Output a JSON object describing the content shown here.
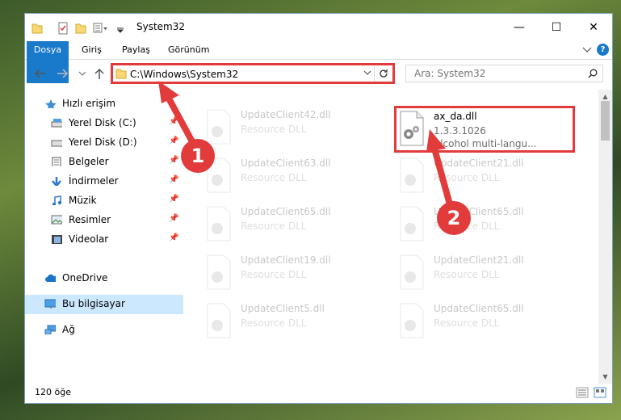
{
  "window": {
    "title": "System32",
    "minimize": "—",
    "maximize": "☐",
    "close": "✕"
  },
  "ribbon": {
    "tabs": [
      "Dosya",
      "Giriş",
      "Paylaş",
      "Görünüm"
    ],
    "help": "?"
  },
  "address": {
    "path": "C:\\Windows\\System32",
    "search_placeholder": "Ara: System32"
  },
  "sidebar": {
    "items": [
      {
        "label": "Hızlı erişim",
        "icon": "star-icon",
        "pinned": false
      },
      {
        "label": "Yerel Disk (C:)",
        "icon": "drive-icon",
        "pinned": true
      },
      {
        "label": "Yerel Disk (D:)",
        "icon": "drive-icon",
        "pinned": true
      },
      {
        "label": "Belgeler",
        "icon": "documents-icon",
        "pinned": true
      },
      {
        "label": "İndirmeler",
        "icon": "download-icon",
        "pinned": true
      },
      {
        "label": "Müzik",
        "icon": "music-icon",
        "pinned": true
      },
      {
        "label": "Resimler",
        "icon": "pictures-icon",
        "pinned": true
      },
      {
        "label": "Videolar",
        "icon": "video-icon",
        "pinned": true
      },
      {
        "label": "OneDrive",
        "icon": "cloud-icon",
        "pinned": false
      },
      {
        "label": "Bu bilgisayar",
        "icon": "computer-icon",
        "pinned": false,
        "selected": true
      },
      {
        "label": "Ağ",
        "icon": "network-icon",
        "pinned": false
      }
    ]
  },
  "files": [
    {
      "name": "UpdateClient42.dll",
      "detail": "Resource DLL",
      "faded": true
    },
    {
      "name": "ax_da.dll",
      "version": "1.3.3.1026",
      "detail": "Alcohol multi-langu...",
      "faded": false
    },
    {
      "name": "UpdateClient63.dll",
      "detail": "Resource DLL",
      "faded": true
    },
    {
      "name": "UpdateClient21.dll",
      "detail": "Resource DLL",
      "faded": true
    },
    {
      "name": "UpdateClient65.dll",
      "detail": "Resource DLL",
      "faded": true
    },
    {
      "name": "UpdateClient65.dll",
      "detail": "Resource DLL",
      "faded": true
    },
    {
      "name": "UpdateClient19.dll",
      "detail": "Resource DLL",
      "faded": true
    },
    {
      "name": "UpdateClient21.dll",
      "detail": "Resource DLL",
      "faded": true
    },
    {
      "name": "UpdateClient5.dll",
      "detail": "Resource DLL",
      "faded": true
    },
    {
      "name": "UpdateClient65.dll",
      "detail": "Resource DLL",
      "faded": true
    }
  ],
  "status": {
    "item_count": "120 öğe"
  },
  "annotations": {
    "step1": "1",
    "step2": "2",
    "color": "#e23b3b"
  }
}
